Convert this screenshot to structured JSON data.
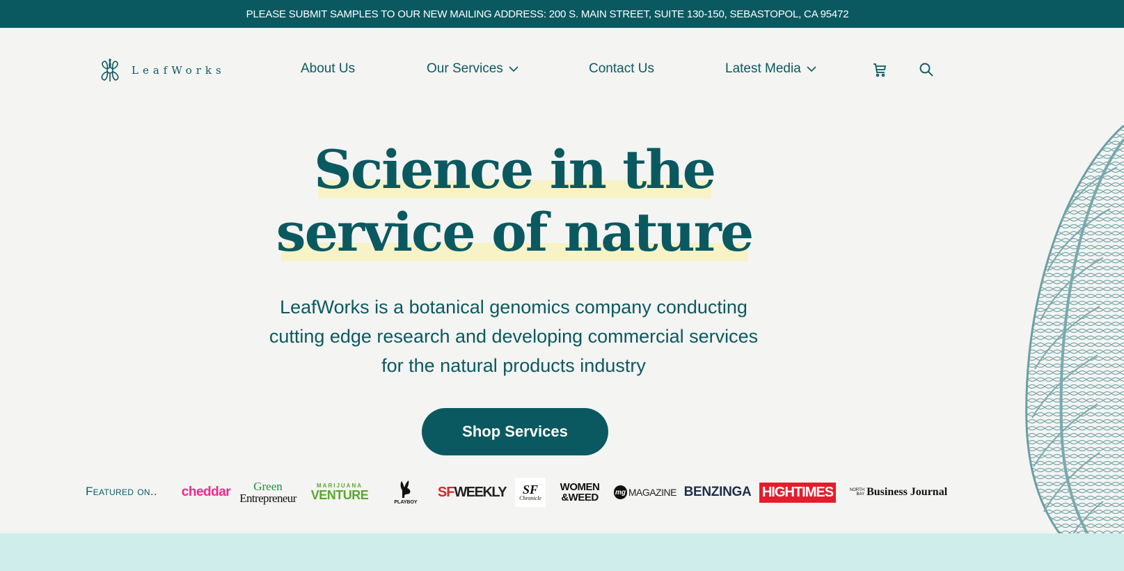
{
  "announcement": "PLEASE SUBMIT SAMPLES TO OUR NEW MAILING ADDRESS: 200 S. MAIN STREET, SUITE 130-150, SEBASTOPOL, CA 95472",
  "brand": {
    "name": "LeafWorks"
  },
  "nav": {
    "about": "About Us",
    "services": "Our Services",
    "contact": "Contact Us",
    "media": "Latest Media"
  },
  "icons": {
    "cart": "cart-icon",
    "search": "search-icon",
    "chevron": "chevron-down-icon"
  },
  "hero": {
    "line1": "Science in the",
    "line2": "service of nature",
    "sub1": "LeafWorks is a botanical genomics company conducting",
    "sub2": "cutting edge research and developing commercial services",
    "sub3": "for the natural products industry",
    "cta": "Shop Services"
  },
  "press": {
    "label": "Featured on..",
    "logos": {
      "cheddar": "cheddar",
      "green1": "Green",
      "green2": "Entrepreneur",
      "mj1": "MARIJUANA",
      "mj2": "VENTURE",
      "playboy": "PLAYBOY",
      "sfweekly1": "SF",
      "sfweekly2": "WEEKLY",
      "sfc1": "SF",
      "sfc2": "Chronicle",
      "ww1": "WOMEN",
      "ww2": "&WEED",
      "mg1": "mg",
      "mg2": "MAGAZINE",
      "benzinga": "BENZINGA",
      "hightimes": "HIGHTIMES",
      "nbbj1": "NORTH",
      "nbbj2": "BAY",
      "nbbj3": "Business Journal"
    }
  },
  "colors": {
    "brand": "#0b5960",
    "highlight": "#f7f3c6",
    "background": "#f4f4f2",
    "band": "#cfedea",
    "cheddar": "#f2288d",
    "hightimes": "#e41d2c",
    "venture": "#5aa72f"
  }
}
